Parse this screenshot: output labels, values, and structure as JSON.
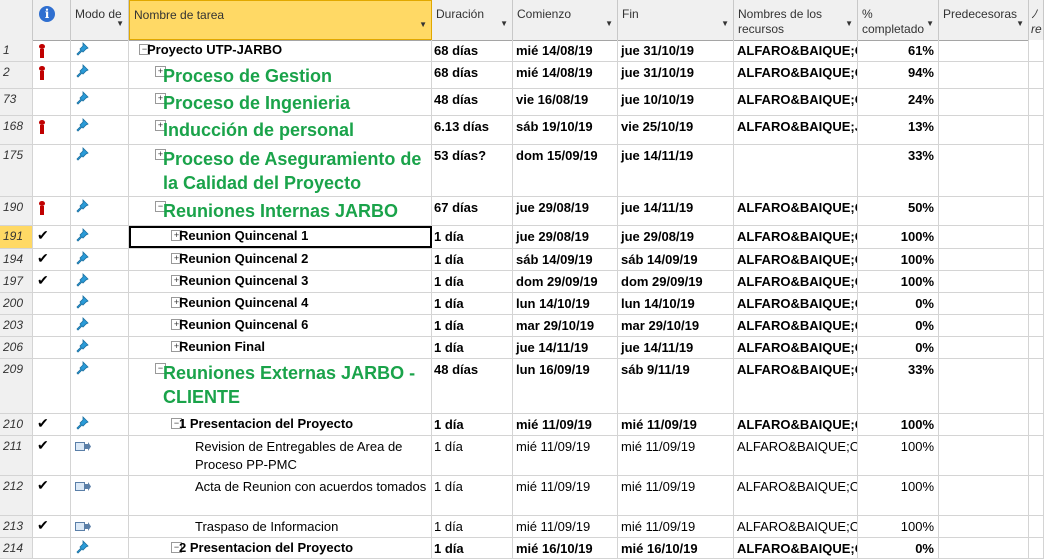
{
  "headers": {
    "mode": "Modo de",
    "name": "Nombre de tarea",
    "duration": "Duración",
    "start": "Comienzo",
    "finish": "Fin",
    "resources": "Nombres de los recursos",
    "pct": "% completado",
    "pred": "Predecesoras",
    "extra": "ﾉre"
  },
  "rows": [
    {
      "id": "1",
      "indicator": "person",
      "mode": "pin",
      "name": "Proyecto UTP-JARBO",
      "toggle": "−",
      "level": 0,
      "style": "bold",
      "dur": "68 días",
      "start": "mié 14/08/19",
      "fin": "jue 31/10/19",
      "res": "ALFARO&BAIQUE;C",
      "pct": "61%"
    },
    {
      "id": "2",
      "indicator": "person",
      "mode": "pin",
      "name": "Proceso de Gestion",
      "toggle": "+",
      "level": 1,
      "style": "big",
      "dur": "68 días",
      "start": "mié 14/08/19",
      "fin": "jue 31/10/19",
      "res": "ALFARO&BAIQUE;C",
      "pct": "94%"
    },
    {
      "id": "73",
      "indicator": "",
      "mode": "pin",
      "name": " Proceso de Ingenieria",
      "toggle": "+",
      "level": 1,
      "style": "big",
      "dur": "48 días",
      "start": "vie 16/08/19",
      "fin": "jue 10/10/19",
      "res": "ALFARO&BAIQUE;C",
      "pct": "24%"
    },
    {
      "id": "168",
      "indicator": "person",
      "mode": "pin",
      "name": "Inducción de personal",
      "toggle": "+",
      "level": 1,
      "style": "big",
      "dur": "6.13 días",
      "start": "sáb 19/10/19",
      "fin": "vie 25/10/19",
      "res": "ALFARO&BAIQUE;J.",
      "pct": "13%"
    },
    {
      "id": "175",
      "indicator": "",
      "mode": "pin",
      "name": "Proceso de Aseguramiento de la Calidad del Proyecto",
      "toggle": "+",
      "level": 1,
      "style": "big",
      "dur": "53 días?",
      "start": "dom 15/09/19",
      "fin": "jue 14/11/19",
      "res": "",
      "pct": "33%"
    },
    {
      "id": "190",
      "indicator": "person",
      "mode": "pin",
      "name": "Reuniones Internas JARBO",
      "toggle": "−",
      "level": 1,
      "style": "big",
      "dur": "67 días",
      "start": "jue 29/08/19",
      "fin": "jue 14/11/19",
      "res": "ALFARO&BAIQUE;C",
      "pct": "50%"
    },
    {
      "id": "191",
      "indicator": "check",
      "mode": "pin",
      "name": "Reunion Quincenal 1",
      "toggle": "+",
      "level": 2,
      "style": "bold",
      "dur": "1 día",
      "start": "jue 29/08/19",
      "fin": "jue 29/08/19",
      "res": "ALFARO&BAIQUE;C",
      "pct": "100%",
      "selected": true
    },
    {
      "id": "194",
      "indicator": "check",
      "mode": "pin",
      "name": "Reunion Quincenal 2",
      "toggle": "+",
      "level": 2,
      "style": "bold",
      "dur": "1 día",
      "start": "sáb 14/09/19",
      "fin": "sáb 14/09/19",
      "res": "ALFARO&BAIQUE;C",
      "pct": "100%"
    },
    {
      "id": "197",
      "indicator": "check",
      "mode": "pin",
      "name": "Reunion Quincenal 3",
      "toggle": "+",
      "level": 2,
      "style": "bold",
      "dur": "1 día",
      "start": "dom 29/09/19",
      "fin": "dom 29/09/19",
      "res": "ALFARO&BAIQUE;C",
      "pct": "100%"
    },
    {
      "id": "200",
      "indicator": "",
      "mode": "pin",
      "name": "Reunion Quincenal 4",
      "toggle": "+",
      "level": 2,
      "style": "bold",
      "dur": "1 día",
      "start": "lun 14/10/19",
      "fin": "lun 14/10/19",
      "res": "ALFARO&BAIQUE;C",
      "pct": "0%"
    },
    {
      "id": "203",
      "indicator": "",
      "mode": "pin",
      "name": "Reunion Quincenal 6",
      "toggle": "+",
      "level": 2,
      "style": "bold",
      "dur": "1 día",
      "start": "mar 29/10/19",
      "fin": "mar 29/10/19",
      "res": "ALFARO&BAIQUE;C",
      "pct": "0%"
    },
    {
      "id": "206",
      "indicator": "",
      "mode": "pin",
      "name": "Reunion Final",
      "toggle": "+",
      "level": 2,
      "style": "bold",
      "dur": "1 día",
      "start": "jue 14/11/19",
      "fin": "jue 14/11/19",
      "res": "ALFARO&BAIQUE;C",
      "pct": "0%"
    },
    {
      "id": "209",
      "indicator": "",
      "mode": "pin",
      "name": "Reuniones Externas JARBO - CLIENTE",
      "toggle": "−",
      "level": 1,
      "style": "big",
      "dur": "48 días",
      "start": "lun 16/09/19",
      "fin": "sáb 9/11/19",
      "res": "ALFARO&BAIQUE;C",
      "pct": "33%"
    },
    {
      "id": "210",
      "indicator": "check",
      "mode": "pin",
      "name": "1 Presentacion del Proyecto",
      "toggle": "−",
      "level": 2,
      "style": "bold",
      "dur": "1 día",
      "start": "mié 11/09/19",
      "fin": "mié 11/09/19",
      "res": "ALFARO&BAIQUE;C",
      "pct": "100%"
    },
    {
      "id": "211",
      "indicator": "check",
      "mode": "auto",
      "name": "Revision de Entregables de Area de Proceso  PP-PMC",
      "toggle": "",
      "level": 3,
      "style": "plain",
      "dur": "1 día",
      "start": "mié 11/09/19",
      "fin": "mié 11/09/19",
      "res": "ALFARO&BAIQUE;C",
      "pct": "100%"
    },
    {
      "id": "212",
      "indicator": "check",
      "mode": "auto",
      "name": "Acta de Reunion con acuerdos tomados",
      "toggle": "",
      "level": 3,
      "style": "plain",
      "dur": "1 día",
      "start": "mié 11/09/19",
      "fin": "mié 11/09/19",
      "res": "ALFARO&BAIQUE;C",
      "pct": "100%"
    },
    {
      "id": "213",
      "indicator": "check",
      "mode": "auto",
      "name": "Traspaso de Informacion",
      "toggle": "",
      "level": 3,
      "style": "plain",
      "dur": "1 día",
      "start": "mié 11/09/19",
      "fin": "mié 11/09/19",
      "res": "ALFARO&BAIQUE;C",
      "pct": "100%"
    },
    {
      "id": "214",
      "indicator": "",
      "mode": "pin",
      "name": "2 Presentacion del Proyecto",
      "toggle": "−",
      "level": 2,
      "style": "bold",
      "dur": "1 día",
      "start": "mié 16/10/19",
      "fin": "mié 16/10/19",
      "res": "ALFARO&BAIQUE;C",
      "pct": "0%"
    }
  ]
}
